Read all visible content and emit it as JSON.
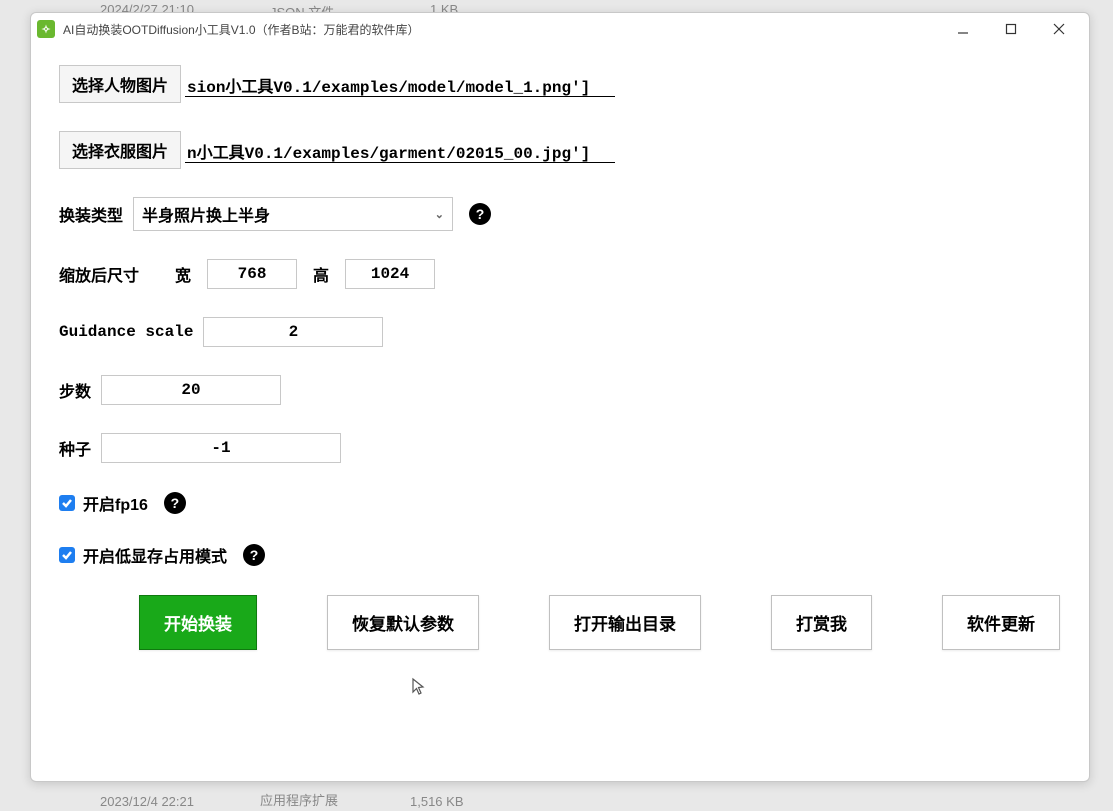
{
  "window": {
    "title": "AI自动换装OOTDiffusion小工具V1.0（作者B站：万能君的软件库）"
  },
  "background": {
    "top_date": "2024/2/27 21:10",
    "top_type": "JSON 文件",
    "top_size": "1 KB",
    "bottom_date": "2023/12/4 22:21",
    "bottom_type": "应用程序扩展",
    "bottom_size": "1,516 KB"
  },
  "fields": {
    "person_image": {
      "button": "选择人物图片",
      "value": "sion小工具V0.1/examples/model/model_1.png']"
    },
    "garment_image": {
      "button": "选择衣服图片",
      "value": "n小工具V0.1/examples/garment/02015_00.jpg']"
    },
    "tryon_type": {
      "label": "换装类型",
      "value": "半身照片换上半身"
    },
    "resize": {
      "label": "缩放后尺寸",
      "width_label": "宽",
      "width": "768",
      "height_label": "高",
      "height": "1024"
    },
    "guidance": {
      "label": "Guidance scale",
      "value": "2"
    },
    "steps": {
      "label": "步数",
      "value": "20"
    },
    "seed": {
      "label": "种子",
      "value": "-1"
    },
    "fp16": {
      "label": "开启fp16",
      "checked": true
    },
    "lowvram": {
      "label": "开启低显存占用模式",
      "checked": true
    }
  },
  "buttons": {
    "start": "开始换装",
    "reset": "恢复默认参数",
    "open_output": "打开输出目录",
    "donate": "打赏我",
    "update": "软件更新"
  }
}
